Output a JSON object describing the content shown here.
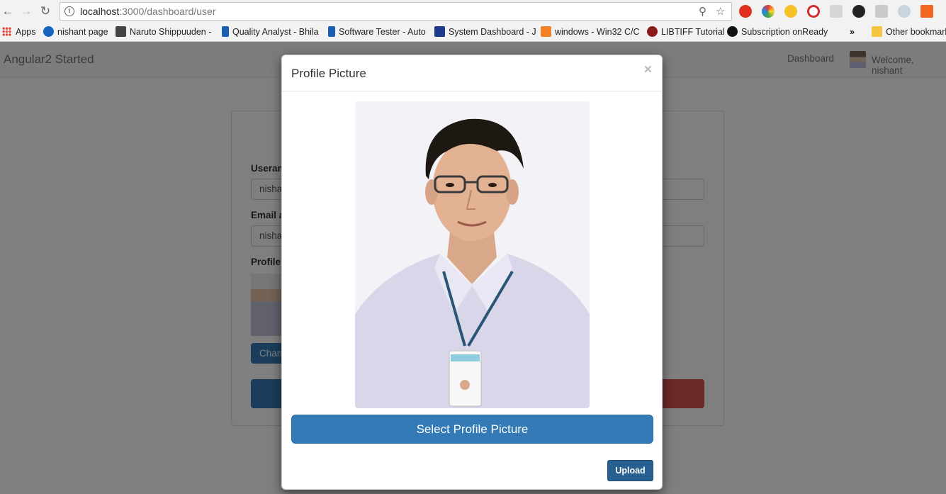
{
  "browser": {
    "url_host": "localhost",
    "url_path": ":3000/dashboard/user",
    "bookmarks": [
      {
        "label": "Apps"
      },
      {
        "label": "nishant page"
      },
      {
        "label": "Naruto Shippuuden -"
      },
      {
        "label": "Quality Analyst - Bhila"
      },
      {
        "label": "Software Tester - Auto"
      },
      {
        "label": "System Dashboard - J"
      },
      {
        "label": "windows - Win32 C/C"
      },
      {
        "label": "LIBTIFF Tutorial"
      },
      {
        "label": "Subscription onReady"
      },
      {
        "label": "»"
      },
      {
        "label": "Other bookmarks"
      }
    ]
  },
  "app": {
    "brand": "Angular2 Started",
    "nav_dashboard": "Dashboard",
    "nav_welcome": "Welcome, nishant",
    "form": {
      "username_label": "Useram",
      "username_value": "nisha",
      "email_label": "Email a",
      "email_value": "nisha",
      "profile_label": "Profile",
      "change_button": "Chan"
    }
  },
  "modal": {
    "title": "Profile Picture",
    "close": "×",
    "select_button": "Select Profile Picture",
    "upload_button": "Upload"
  },
  "colors": {
    "primary": "#337ab7",
    "primary_dark": "#286090",
    "danger": "#d9534f"
  }
}
